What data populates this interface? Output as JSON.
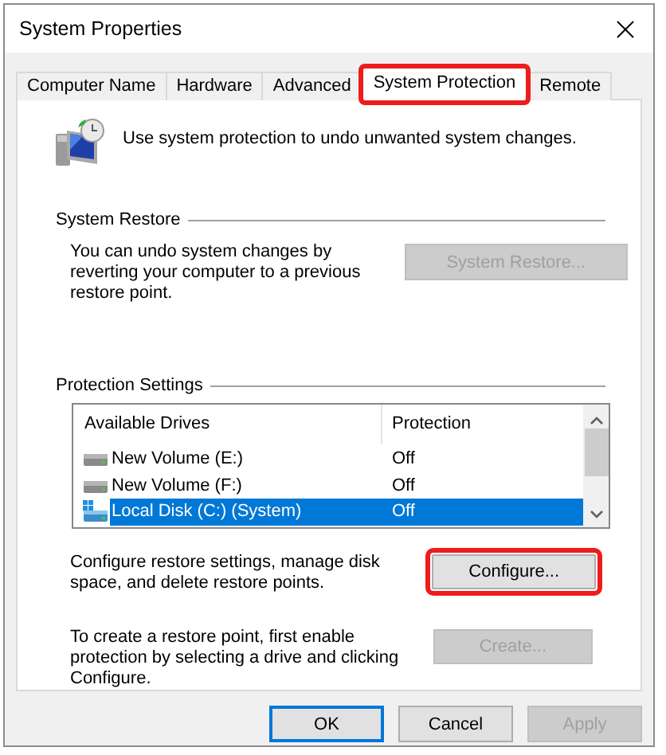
{
  "window": {
    "title": "System Properties"
  },
  "tabs": [
    {
      "label": "Computer Name",
      "selected": false,
      "highlighted": false
    },
    {
      "label": "Hardware",
      "selected": false,
      "highlighted": false
    },
    {
      "label": "Advanced",
      "selected": false,
      "highlighted": false
    },
    {
      "label": "System Protection",
      "selected": true,
      "highlighted": true
    },
    {
      "label": "Remote",
      "selected": false,
      "highlighted": false
    }
  ],
  "intro": "Use system protection to undo unwanted system changes.",
  "system_restore": {
    "heading": "System Restore",
    "description": "You can undo system changes by reverting your computer to a previous restore point.",
    "button": {
      "label": "System Restore...",
      "disabled": true,
      "highlighted": false
    }
  },
  "protection_settings": {
    "heading": "Protection Settings",
    "columns": [
      "Available Drives",
      "Protection"
    ],
    "drives": [
      {
        "name": "New Volume (E:)",
        "protection": "Off",
        "kind": "disk",
        "selected": false
      },
      {
        "name": "New Volume (F:)",
        "protection": "Off",
        "kind": "disk",
        "selected": false
      },
      {
        "name": "Local Disk (C:) (System)",
        "protection": "Off",
        "kind": "system",
        "selected": true
      }
    ],
    "configure": {
      "description": "Configure restore settings, manage disk space, and delete restore points.",
      "button": {
        "label": "Configure...",
        "disabled": false,
        "highlighted": true
      }
    },
    "create": {
      "description": "To create a restore point, first enable protection by selecting a drive and clicking Configure.",
      "button": {
        "label": "Create...",
        "disabled": true,
        "highlighted": false
      }
    }
  },
  "buttons": [
    {
      "label": "OK",
      "default": true,
      "disabled": false
    },
    {
      "label": "Cancel",
      "default": false,
      "disabled": false
    },
    {
      "label": "Apply",
      "default": false,
      "disabled": true
    }
  ]
}
